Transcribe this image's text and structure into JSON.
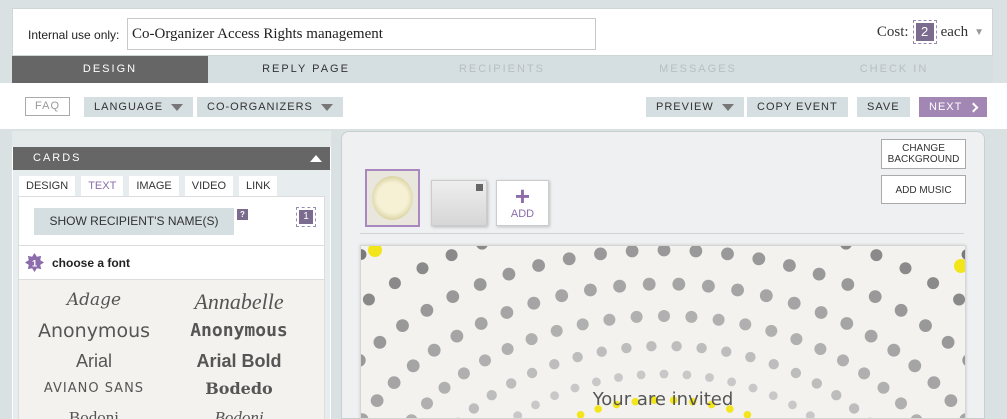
{
  "header": {
    "internal_label": "Internal use only:",
    "internal_value": "Co-Organizer Access Rights management",
    "cost_label": "Cost:",
    "cost_value": "2",
    "cost_unit": "each"
  },
  "tabs": [
    {
      "label": "DESIGN",
      "state": "active"
    },
    {
      "label": "REPLY PAGE",
      "state": "normal"
    },
    {
      "label": "RECIPIENTS",
      "state": "disabled"
    },
    {
      "label": "MESSAGES",
      "state": "disabled"
    },
    {
      "label": "CHECK IN",
      "state": "disabled"
    }
  ],
  "toolbar": {
    "faq": "FAQ",
    "language": "LANGUAGE",
    "coorganizers": "CO-ORGANIZERS",
    "preview": "PREVIEW",
    "copy_event": "COPY EVENT",
    "save": "SAVE",
    "next": "NEXT"
  },
  "cards": {
    "header": "CARDS",
    "subtabs": [
      "DESIGN",
      "TEXT",
      "IMAGE",
      "VIDEO",
      "LINK"
    ],
    "active_subtab": "TEXT",
    "show_recipient": "SHOW RECIPIENT'S NAME(S)",
    "help_badge": "?",
    "count_badge": "1",
    "step_number": "1",
    "choose_font": "choose a font",
    "fonts": [
      "Adage",
      "Annabelle",
      "Anonymous",
      "Anonymous",
      "Arial",
      "Arial Bold",
      "Aviano Sans",
      "Bodedo",
      "Bodoni",
      "Bodoni"
    ]
  },
  "design": {
    "change_background": "CHANGE BACKGROUND",
    "add_music": "ADD MUSIC",
    "add_label": "ADD",
    "add_plus": "+",
    "invited_text": "Your are invited"
  },
  "colors": {
    "accent": "#a287b4",
    "active_tab": "#666666",
    "button_bg": "#d5dee0",
    "dot_yellow": "#f2e51a",
    "dot_gray": "#9a9a9a"
  }
}
